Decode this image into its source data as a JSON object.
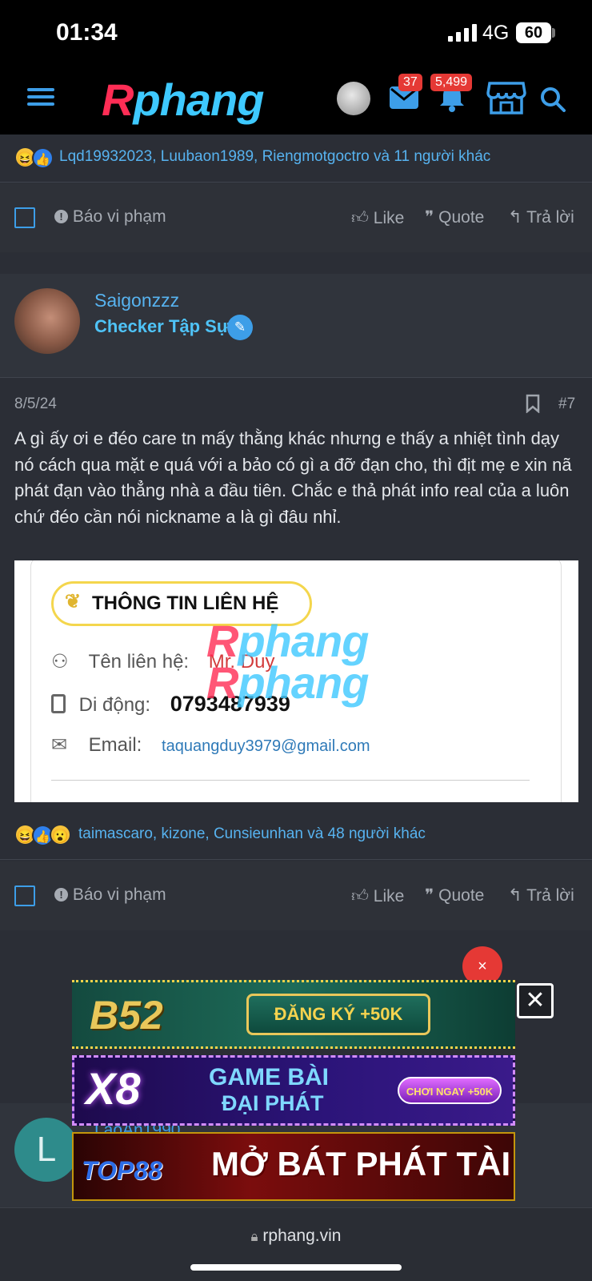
{
  "status": {
    "time": "01:34",
    "network": "4G",
    "battery": "60"
  },
  "header": {
    "logo_r": "R",
    "logo_rest": "phang",
    "messages_badge": "37",
    "alerts_badge": "5,499"
  },
  "prev_post": {
    "reactions_text": "Lqd19932023, Luubaon1989, Riengmotgoctro và 11 người khác",
    "report": "Báo vi phạm",
    "like": "Like",
    "quote": "Quote",
    "reply": "Trả lời"
  },
  "post": {
    "username": "Saigonzzz",
    "user_title": "Checker Tập Sự",
    "date": "8/5/24",
    "number": "#7",
    "body": "A gì ấy ơi e đéo care tn mấy thằng khác nhưng e thấy a nhiệt tình dạy nó cách qua mặt e quá với a bảo có gì a đỡ đạn cho, thì địt mẹ e xin nã phát đạn vào thẳng nhà a đầu tiên. Chắc e thả phát info real của a luôn chứ đéo cần nói nickname a là gì đâu nhỉ.",
    "contact_card": {
      "title": "THÔNG TIN LIÊN HỆ",
      "name_label": "Tên liên hệ:",
      "name_value": "Mr. Duy",
      "phone_label": "Di động:",
      "phone_value": "0793487939",
      "email_label": "Email:",
      "email_value": "taquangduy3979@gmail.com"
    },
    "reactions_text": "taimascaro, kizone, Cunsieunhan và 48 người khác",
    "report": "Báo vi phạm",
    "like": "Like",
    "quote": "Quote",
    "reply": "Trả lời"
  },
  "ads": {
    "ad1_brand": "B52",
    "ad1_cta": "ĐĂNG KÝ +50K",
    "ad2_brand": "X8",
    "ad2_line1": "GAME BÀI",
    "ad2_line2": "ĐẠI PHÁT",
    "ad2_cta": "CHƠI NGAY +50K",
    "ad3_brand": "TOP88",
    "ad3_text": "MỞ BÁT PHÁT TÀI",
    "close_x": "×",
    "close_box": "✕"
  },
  "next_post": {
    "avatar_letter": "L",
    "username_partial": "LaoAn1990"
  },
  "browser": {
    "url": "rphang.vin"
  },
  "colors": {
    "link": "#57b3f0",
    "accent": "#3d9ee8",
    "badge": "#e53935",
    "background": "#2b2e36"
  }
}
